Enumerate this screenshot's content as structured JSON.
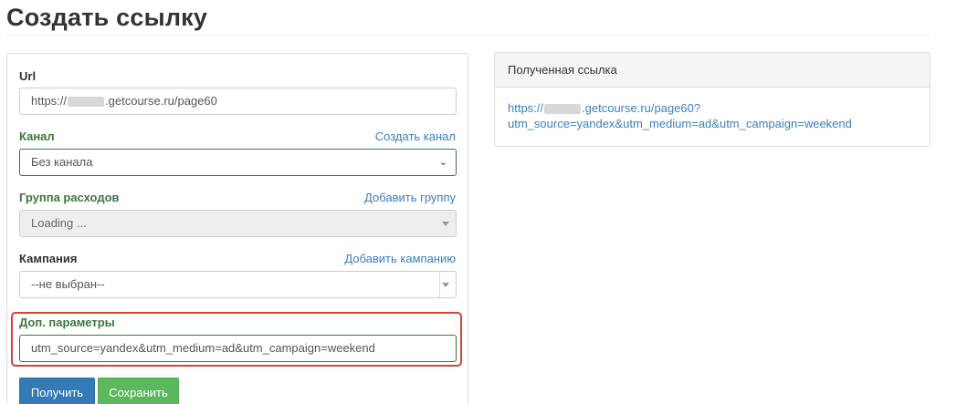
{
  "page": {
    "title": "Создать ссылку"
  },
  "form": {
    "url": {
      "label": "Url",
      "value_prefix": "https://",
      "value_suffix": ".getcourse.ru/page60"
    },
    "channel": {
      "label": "Канал",
      "link": "Создать канал",
      "value": "Без канала"
    },
    "expense_group": {
      "label": "Группа расходов",
      "link": "Добавить группу",
      "value": "Loading ..."
    },
    "campaign": {
      "label": "Кампания",
      "link": "Добавить кампанию",
      "value": "--не выбран--"
    },
    "extra_params": {
      "label": "Доп. параметры",
      "value": "utm_source=yandex&utm_medium=ad&utm_campaign=weekend"
    },
    "buttons": {
      "get": "Получить",
      "save": "Сохранить"
    }
  },
  "result": {
    "title": "Полученная ссылка",
    "link_prefix": "https://",
    "link_line1_suffix": ".getcourse.ru/page60?",
    "link_line2": "utm_source=yandex&utm_medium=ad&utm_campaign=weekend"
  },
  "colors": {
    "link": "#3a7fc0",
    "label_green": "#3c763d",
    "highlight": "#d9403a",
    "primary": "#337ab7",
    "success": "#5cb85c"
  }
}
